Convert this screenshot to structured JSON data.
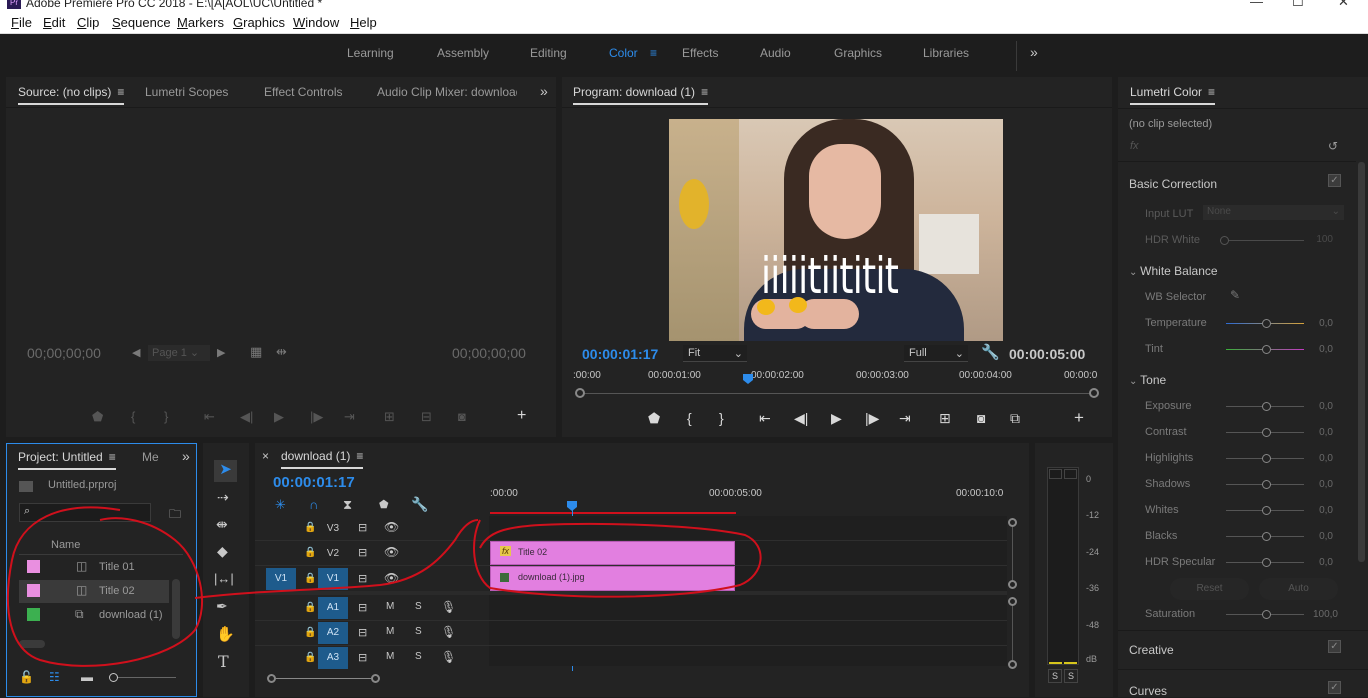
{
  "window": {
    "title": "Adobe Premiere Pro CC 2018 - E:\\[A[AOL\\UC\\Untitled *",
    "logo": "Pr",
    "minimize": "—",
    "maximize": "☐",
    "close": "✕"
  },
  "menu": [
    {
      "first": "F",
      "rest": "ile"
    },
    {
      "first": "E",
      "rest": "dit"
    },
    {
      "first": "C",
      "rest": "lip"
    },
    {
      "first": "S",
      "rest": "equence"
    },
    {
      "first": "M",
      "rest": "arkers"
    },
    {
      "first": "G",
      "rest": "raphics"
    },
    {
      "first": "W",
      "rest": "indow"
    },
    {
      "first": "H",
      "rest": "elp"
    }
  ],
  "workspaces": {
    "items": [
      "Learning",
      "Assembly",
      "Editing",
      "Color",
      "Effects",
      "Audio",
      "Graphics",
      "Libraries"
    ],
    "active": "Color",
    "more": "»"
  },
  "source_panel": {
    "tabs": [
      "Source: (no clips)",
      "Lumetri Scopes",
      "Effect Controls",
      "Audio Clip Mixer: download ("
    ],
    "tc_left": "00;00;00;00",
    "tc_right": "00;00;00;00",
    "page": "Page 1"
  },
  "program_panel": {
    "tab": "Program: download (1)",
    "overlay_text": "iiiiitiititit",
    "timecode": "00:00:01:17",
    "fit": "Fit",
    "quality": "Full",
    "duration": "00:00:05:00",
    "ruler": [
      ":00:00",
      "00:00:01:00",
      "00:00:02:00",
      "00:00:03:00",
      "00:00:04:00",
      "00:00:0"
    ]
  },
  "project_panel": {
    "tab": "Project: Untitled",
    "tab2": "Me",
    "file": "Untitled.prproj",
    "column": "Name",
    "items": [
      {
        "name": "Title 01",
        "color": "#e98fe0"
      },
      {
        "name": "Title 02",
        "color": "#e98fe0"
      },
      {
        "name": "download (1)",
        "color": "#3cb050"
      }
    ]
  },
  "timeline": {
    "tab": "download (1)",
    "timecode": "00:00:01:17",
    "ruler": [
      ":00:00",
      "00:00:05:00",
      "00:00:10:0"
    ],
    "video_tracks": [
      "V3",
      "V2",
      "V1"
    ],
    "audio_tracks": [
      "A1",
      "A2",
      "A3"
    ],
    "source_v1": "V1",
    "m": "M",
    "s": "S",
    "clips": [
      {
        "name": "Title 02",
        "badge": "fx"
      },
      {
        "name": "download (1).jpg"
      }
    ]
  },
  "meter": {
    "scale": [
      "0",
      "-12",
      "-24",
      "-36",
      "-48",
      "dB"
    ],
    "solo": [
      "S",
      "S"
    ]
  },
  "lumetri": {
    "tab": "Lumetri Color",
    "no_clip": "(no clip selected)",
    "fx": "fx",
    "basic": "Basic Correction",
    "input_lut": "Input LUT",
    "input_lut_value": "None",
    "hdr_white": "HDR White",
    "hdr_white_value": "100",
    "white_balance": "White Balance",
    "wb_selector": "WB Selector",
    "temperature": "Temperature",
    "tint": "Tint",
    "tone": "Tone",
    "tone_rows": [
      "Exposure",
      "Contrast",
      "Highlights",
      "Shadows",
      "Whites",
      "Blacks",
      "HDR Specular"
    ],
    "zero": "0,0",
    "reset": "Reset",
    "auto": "Auto",
    "saturation": "Saturation",
    "saturation_value": "100,0",
    "creative": "Creative",
    "curves": "Curves"
  }
}
